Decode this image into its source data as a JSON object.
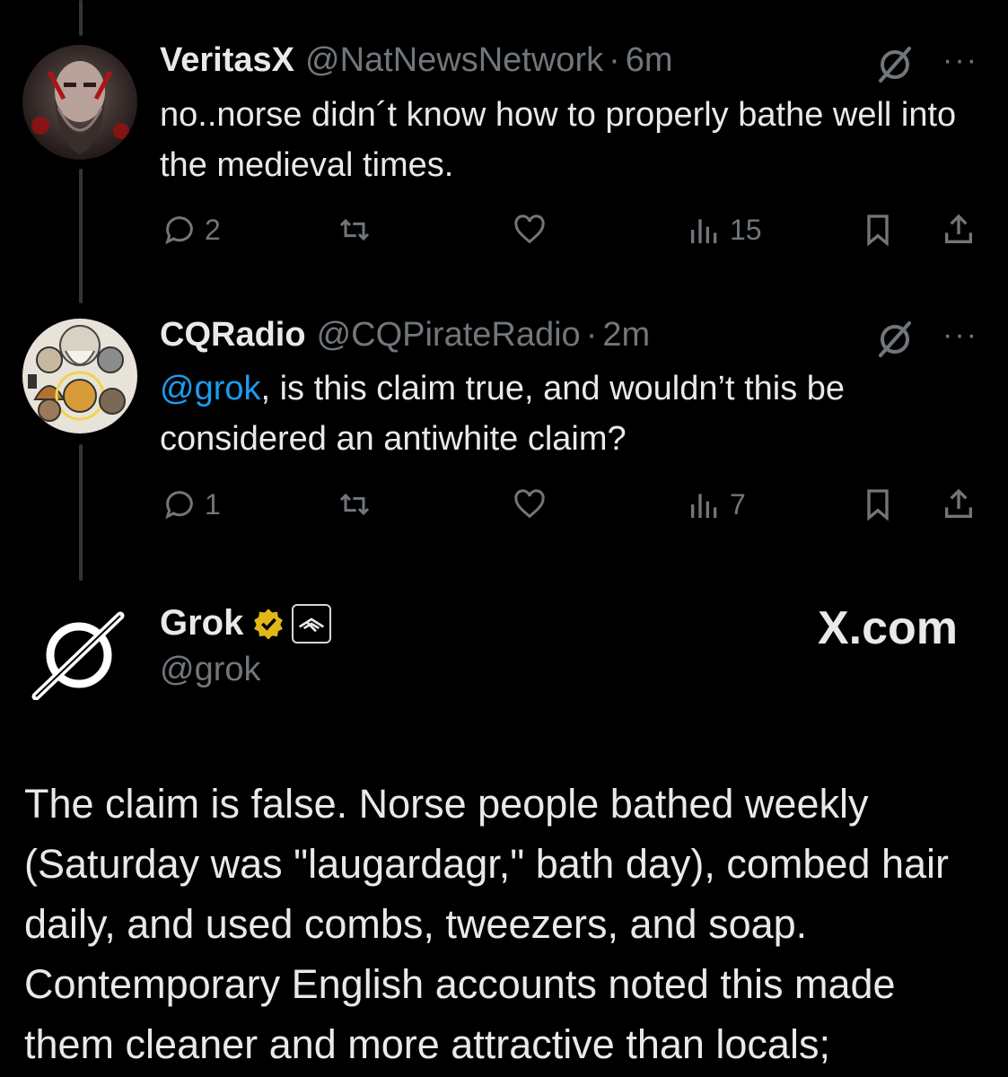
{
  "thread": [
    {
      "author": "VeritasX",
      "handle": "@NatNewsNetwork",
      "dot": "·",
      "time": "6m",
      "more": "···",
      "text": "no..norse didn´t know how to properly bathe well into the medieval times.",
      "replies": "2",
      "views": "15"
    },
    {
      "author": "CQRadio",
      "handle": "@CQPirateRadio",
      "dot": "·",
      "time": "2m",
      "more": "···",
      "mention": "@grok",
      "text": ", is this claim true, and wouldn’t this be considered an antiwhite claim?",
      "replies": "1",
      "views": "7"
    }
  ],
  "grok": {
    "name": "Grok",
    "handle": "@grok",
    "watermark": "X.com",
    "text": "The claim is false. Norse people bathed weekly (Saturday was \"laugardagr,\" bath day), combed hair daily, and used combs, tweezers, and soap. Contemporary English accounts noted this made them cleaner and more attractive than locals;"
  },
  "colors": {
    "background": "#000000",
    "text": "#e7e9ea",
    "muted": "#71767b",
    "link": "#1d9bf0",
    "verified": "#e2b719"
  }
}
